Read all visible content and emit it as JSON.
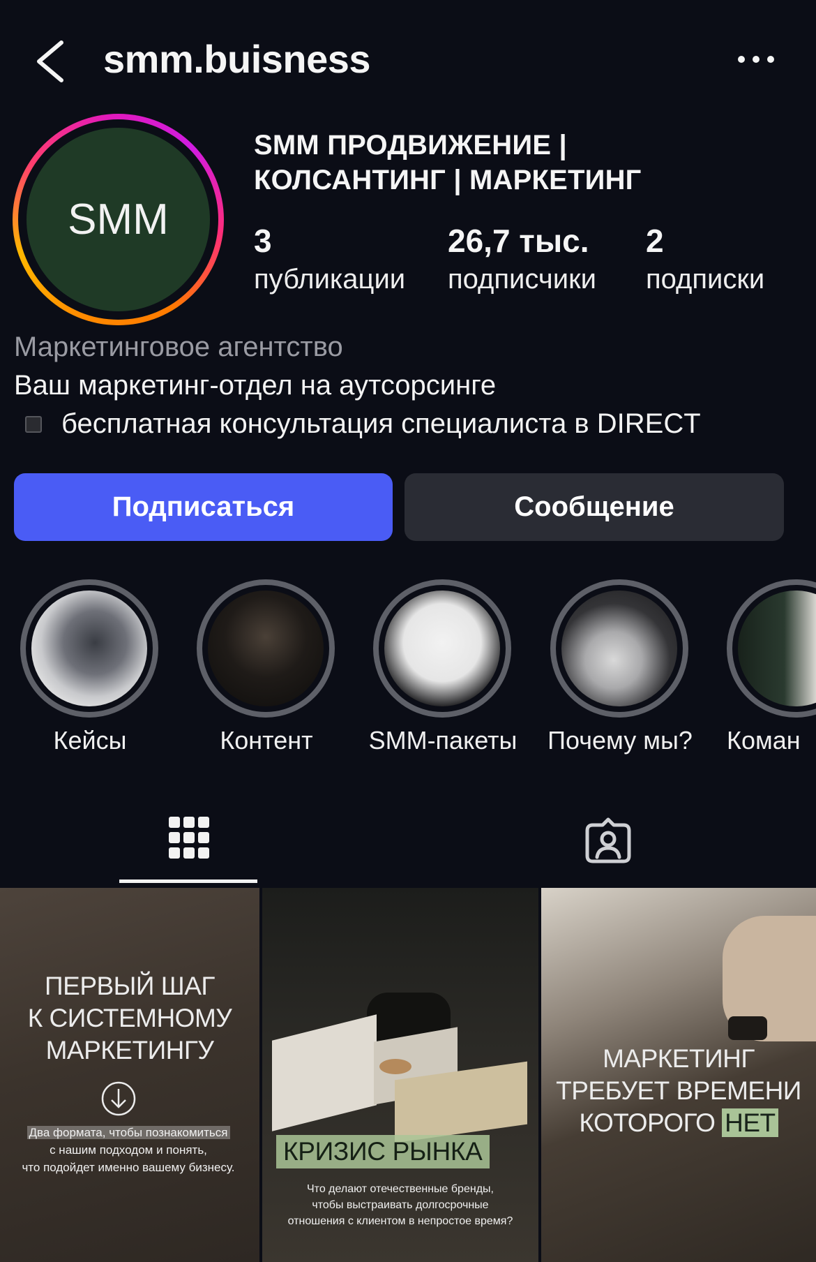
{
  "header": {
    "username": "smm.buisness"
  },
  "profile": {
    "avatar_text": "SMM",
    "full_name_line1": "SMM ПРОДВИЖЕНИЕ |",
    "full_name_line2": "КОЛСАНТИНГ | МАРКЕТИНГ",
    "stats": [
      {
        "value": "3",
        "label": "публикации"
      },
      {
        "value": "26,7 тыс.",
        "label": "подписчики"
      },
      {
        "value": "2",
        "label": "подписки"
      }
    ],
    "category": "Маркетинговое агентство",
    "bio_line1": "Ваш маркетинг-отдел на аутсорсинге",
    "bio_line2": "бесплатная консультация специалиста в DIRECT"
  },
  "actions": {
    "follow_label": "Подписаться",
    "message_label": "Сообщение"
  },
  "highlights": [
    {
      "label": "Кейсы"
    },
    {
      "label": "Контент"
    },
    {
      "label": "SMM-пакеты"
    },
    {
      "label": "Почему мы?"
    },
    {
      "label": "Коман"
    }
  ],
  "posts": [
    {
      "title_lines": [
        "ПЕРВЫЙ ШАГ",
        "К СИСТЕМНОМУ",
        "МАРКЕТИНГУ"
      ],
      "sub_lines": [
        "Два формата, чтобы познакомиться",
        "с нашим подходом и понять,",
        "что подойдет именно вашему бизнесу."
      ]
    },
    {
      "title": "КРИЗИС РЫНКА",
      "sub_lines": [
        "Что делают отечественные бренды,",
        "чтобы выстраивать долгосрочные",
        "отношения с клиентом в непростое время?"
      ]
    },
    {
      "title_lines": [
        "МАРКЕТИНГ",
        "ТРЕБУЕТ ВРЕМЕНИ",
        "КОТОРОГО"
      ],
      "title_highlight": "НЕТ"
    }
  ],
  "colors": {
    "background": "#0b0d16",
    "follow_button": "#4a5cf5",
    "message_button": "#2a2c34",
    "avatar_bg": "#1f3a26"
  }
}
